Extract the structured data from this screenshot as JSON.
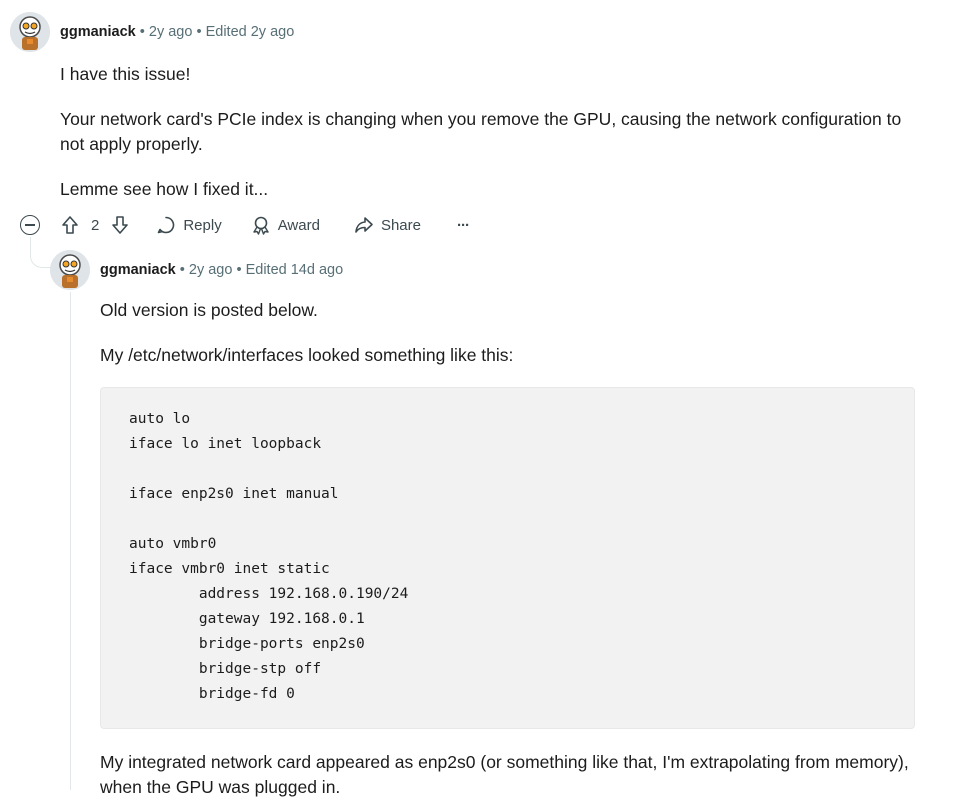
{
  "comment1": {
    "username": "ggmaniack",
    "sep1": "•",
    "age": "2y ago",
    "sep2": "•",
    "edited": "Edited 2y ago",
    "paragraphs": [
      "I have this issue!",
      "Your network card's PCIe index is changing when you remove the GPU, causing the network configuration to not apply properly.",
      "Lemme see how I fixed it..."
    ],
    "actions": {
      "score": "2",
      "reply": "Reply",
      "award": "Award",
      "share": "Share",
      "more": "···"
    }
  },
  "comment2": {
    "username": "ggmaniack",
    "sep1": "•",
    "age": "2y ago",
    "sep2": "•",
    "edited": "Edited 14d ago",
    "paragraphs": [
      "Old version is posted below.",
      "My /etc/network/interfaces looked something like this:"
    ],
    "code_lines": [
      "auto lo",
      "iface lo inet loopback",
      "",
      "iface enp2s0 inet manual",
      "",
      "auto vmbr0",
      "iface vmbr0 inet static",
      "        address 192.168.0.190/24",
      "        gateway 192.168.0.1",
      "        bridge-ports enp2s0",
      "        bridge-stp off",
      "        bridge-fd 0"
    ],
    "after_code": "My integrated network card appeared as enp2s0 (or something like that, I'm extrapolating from memory), when the GPU was plugged in."
  },
  "icons": {
    "collapse": "collapse-icon",
    "upvote": "upvote-arrow-icon",
    "downvote": "downvote-arrow-icon",
    "reply": "speech-bubble-icon",
    "award": "award-ribbon-icon",
    "share": "share-arrow-icon",
    "more": "ellipsis-icon"
  },
  "colors": {
    "meta_text": "#576f76",
    "thread_line": "#e2e7e9",
    "code_background": "#f2f2f2"
  }
}
